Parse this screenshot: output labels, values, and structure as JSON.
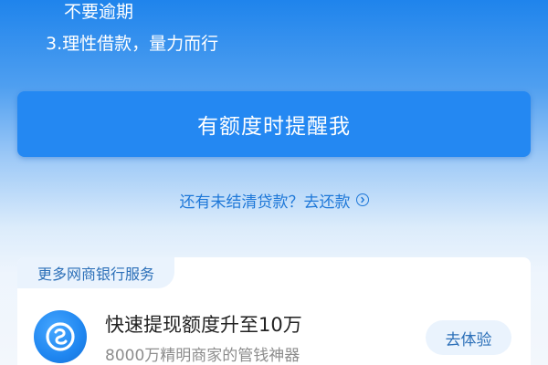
{
  "tips": {
    "line1": "不要逾期",
    "line2": "3.理性借款，量力而行"
  },
  "remind_button": {
    "label": "有额度时提醒我"
  },
  "repay_link": {
    "label": "还有未结清贷款？去还款",
    "icon": "chevron-right-circle-icon"
  },
  "services": {
    "header": "更多网商银行服务",
    "item": {
      "icon": "mybank-logo-icon",
      "title": "快速提现额度升至10万",
      "subtitle": "8000万精明商家的管钱神器",
      "action_label": "去体验"
    }
  },
  "colors": {
    "primary": "#2488f2",
    "link": "#1d77d8",
    "chip_bg": "#eaf3fd",
    "chip_text": "#2b6fb8"
  }
}
